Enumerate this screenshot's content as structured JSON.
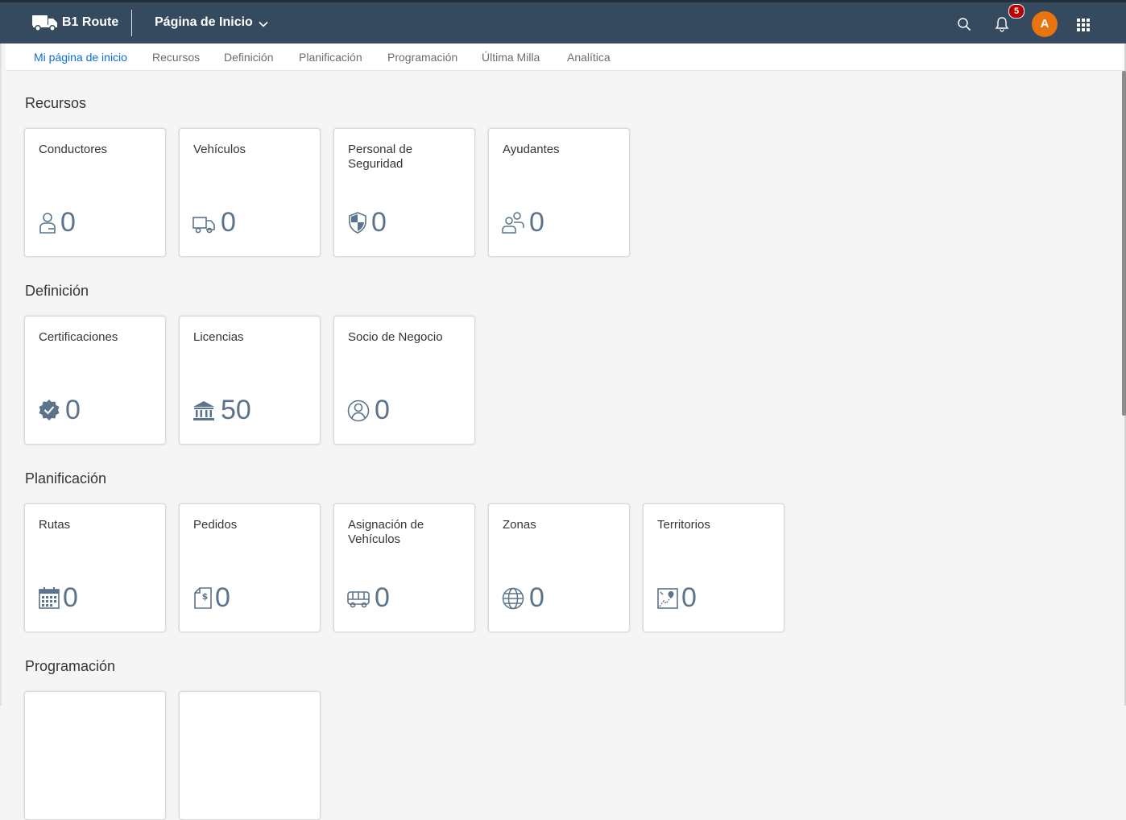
{
  "shell": {
    "app_name": "B1 Route",
    "page_title": "Página de Inicio",
    "notifications_count": "5",
    "avatar_initial": "A"
  },
  "tabs": [
    {
      "label": "Mi página de inicio",
      "active": true
    },
    {
      "label": "Recursos"
    },
    {
      "label": "Definición"
    },
    {
      "label": "Planificación"
    },
    {
      "label": "Programación"
    },
    {
      "label": "Última Milla"
    },
    {
      "label": "Analítica"
    }
  ],
  "sections": [
    {
      "title": "Recursos",
      "tiles": [
        {
          "title": "Conductores",
          "value": "0",
          "icon": "driver-icon"
        },
        {
          "title": "Vehículos",
          "value": "0",
          "icon": "truck-icon"
        },
        {
          "title": "Personal de Seguridad",
          "value": "0",
          "icon": "shield-icon"
        },
        {
          "title": "Ayudantes",
          "value": "0",
          "icon": "helpers-icon"
        }
      ]
    },
    {
      "title": "Definición",
      "tiles": [
        {
          "title": "Certificaciones",
          "value": "0",
          "icon": "certificate-icon"
        },
        {
          "title": "Licencias",
          "value": "50",
          "icon": "institution-icon"
        },
        {
          "title": "Socio de Negocio",
          "value": "0",
          "icon": "partner-icon"
        }
      ]
    },
    {
      "title": "Planificación",
      "tiles": [
        {
          "title": "Rutas",
          "value": "0",
          "icon": "calendar-icon"
        },
        {
          "title": "Pedidos",
          "value": "0",
          "icon": "sales-document-icon"
        },
        {
          "title": "Asignación de Vehículos",
          "value": "0",
          "icon": "bus-icon"
        },
        {
          "title": "Zonas",
          "value": "0",
          "icon": "globe-icon"
        },
        {
          "title": "Territorios",
          "value": "0",
          "icon": "map-icon"
        }
      ]
    },
    {
      "title": "Programación",
      "tiles": []
    }
  ],
  "colors": {
    "shell": "#354a5f",
    "accent": "#0a6ed1",
    "avatar": "#e9730c",
    "badge": "#bb0000",
    "tile_value": "#5b738b"
  }
}
